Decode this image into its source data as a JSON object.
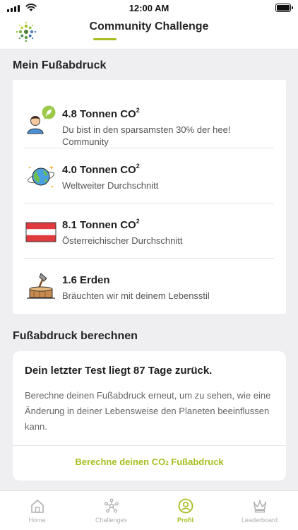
{
  "status_bar": {
    "time": "12:00 AM"
  },
  "header": {
    "title": "Community Challenge",
    "icons": {
      "logo": "dotted-globe-logo"
    }
  },
  "footprint": {
    "section_title": "Mein Fußabdruck",
    "items": [
      {
        "icon": "person-leaf-icon",
        "value": "4.8 Tonnen CO",
        "value_sup": "2",
        "description": "Du bist in den sparsamsten 30% der hee! Community"
      },
      {
        "icon": "globe-icon",
        "value": "4.0 Tonnen CO",
        "value_sup": "2",
        "description": "Weltweiter Durchschnitt"
      },
      {
        "icon": "austria-flag-icon",
        "value": "8.1 Tonnen CO",
        "value_sup": "2",
        "description": "Österreichischer Durchschnitt"
      },
      {
        "icon": "axe-stump-icon",
        "value": "1.6 Erden",
        "value_sup": "",
        "description": "Bräuchten wir mit deinem Lebensstil"
      }
    ]
  },
  "calculate": {
    "section_title": "Fußabdruck berechnen",
    "heading": "Dein letzter Test liegt 87 Tage zurück.",
    "body": "Berechne deinen Fußabdruck erneut, um zu sehen, wie eine Änderung in deiner Lebensweise den Planeten beeinflussen kann.",
    "button_prefix": "Berechne deinen CO",
    "button_sub": "2",
    "button_suffix": " Fußabdruck"
  },
  "tabs": [
    {
      "label": "Home",
      "icon": "home-icon",
      "active": false
    },
    {
      "label": "Challenges",
      "icon": "network-icon",
      "active": false
    },
    {
      "label": "Profil",
      "icon": "profile-icon",
      "active": true
    },
    {
      "label": "Leaderboard",
      "icon": "crown-icon",
      "active": false
    }
  ],
  "colors": {
    "accent": "#a8be22",
    "background": "#efeff1",
    "card": "#ffffff",
    "flag_red": "#e03a3e"
  }
}
